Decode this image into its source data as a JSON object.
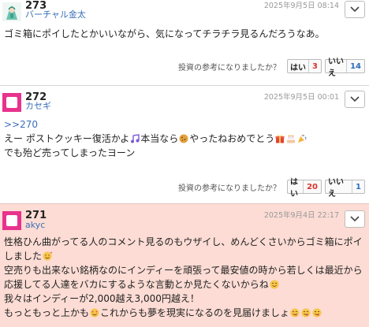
{
  "vote_question": "投資の参考になりましたか？",
  "vote_yes_label": "はい",
  "vote_no_label": "いいえ",
  "posts": [
    {
      "number": "273",
      "username": "バーチャル金太",
      "date": "2025年9月5日 08:14",
      "lines": [
        "ゴミ箱にポイしたとかいいながら、気になってチラチラ見るんだろうなあ。"
      ],
      "yes_count": "3",
      "no_count": "14"
    },
    {
      "number": "272",
      "username": "カセギ",
      "date": "2025年9月5日 00:01",
      "anchor": ">>270",
      "line2_a": "えー ポストクッキー復活かよ",
      "line2_b": "本当なら",
      "line2_c": "やったねおめでとう",
      "line3": "でも殆ど売ってしまったヨーン",
      "yes_count": "20",
      "no_count": "1"
    },
    {
      "number": "271",
      "username": "akyc",
      "date": "2025年9月4日 22:17",
      "lines": [
        "性格ひん曲がってる人のコメント見るのもウザイし、めんどくさいからゴミ箱にポイ",
        "しました",
        "空売りも出来ない銘柄なのにインディーを頑張って最安値の時から若しくは最近から",
        "応援してる人達をバカにするような言動とか見たくないからね",
        "我々はインディーが2,000越え3,000円越え！",
        "もっともっと上かも",
        "これからも夢を現実になるのを見届けましょ"
      ],
      "yes_count": "",
      "no_count": ""
    }
  ],
  "colors": {
    "link": "#3a6fb8",
    "highlight_bg": "#fcdcd4",
    "yes_count": "#d9342b",
    "no_count": "#2f6dbd"
  }
}
